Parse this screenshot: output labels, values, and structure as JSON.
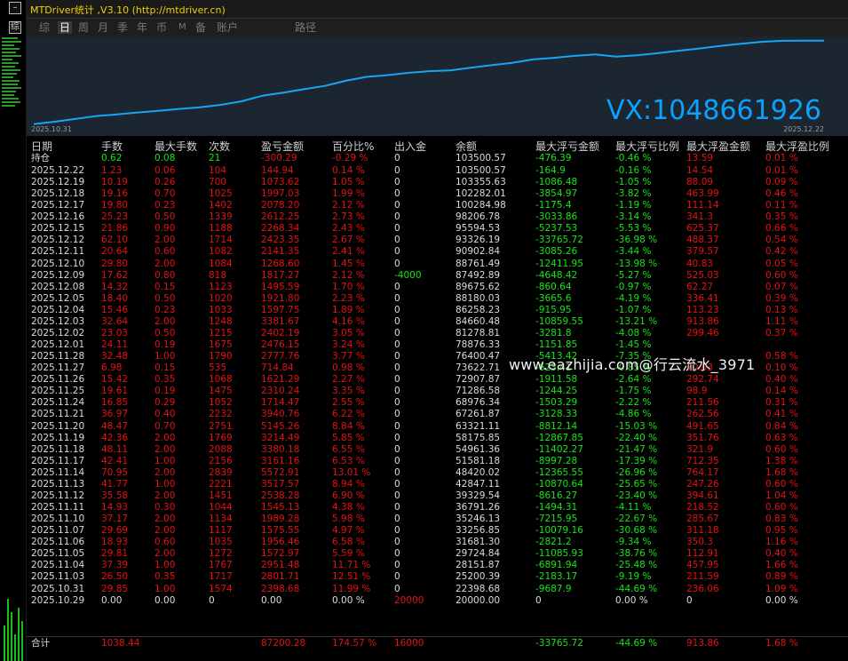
{
  "window": {
    "title": "MTDriver统计 ,V3.10 (http://mtdriver.cn)",
    "left_button": "综"
  },
  "tabs": [
    {
      "label": "综",
      "active": false
    },
    {
      "label": "日",
      "active": true
    },
    {
      "label": "周",
      "active": false
    },
    {
      "label": "月",
      "active": false
    },
    {
      "label": "季",
      "active": false
    },
    {
      "label": "年",
      "active": false
    },
    {
      "label": "币",
      "active": false
    },
    {
      "label": "M",
      "active": false
    },
    {
      "label": "备",
      "active": false
    },
    {
      "label": "账户",
      "active": false
    },
    {
      "label": "路径",
      "active": false
    }
  ],
  "chart_data": {
    "type": "line",
    "series": [
      {
        "values": [
          20000,
          22398.68,
          25200.39,
          28151.87,
          29724.84,
          31681.3,
          33256.85,
          35246.13,
          36791.26,
          39329.54,
          42847.11,
          48420.02,
          51581.18,
          54961.36,
          58175.85,
          63321.11,
          67261.87,
          68976.34,
          71286.58,
          72907.87,
          73622.71,
          76400.47,
          78876.33,
          81278.81,
          84660.48,
          86258.23,
          88180.03,
          89675.62,
          87492.89,
          88761.49,
          90902.84,
          93326.19,
          95594.53,
          98206.78,
          100284.98,
          102282.01,
          103355.63,
          103500.57,
          103500.57
        ]
      }
    ],
    "x_start": "2025.10.31",
    "x_end": "2025.12.22",
    "color": "#15a6f5",
    "background": "#1c2630"
  },
  "chart_overlay": "VX:1048661926",
  "site_watermark": "www.eazhijia.com@行云流水_3971",
  "columns": [
    "日期",
    "手数",
    "最大手数",
    "次数",
    "盈亏金额",
    "百分比%",
    "出入金",
    "余额",
    "最大浮亏金额",
    "最大浮亏比例",
    "最大浮盈金额",
    "最大浮盈比例"
  ],
  "holding": {
    "date": "持仓",
    "lots": "0.62",
    "max_lots": "0.08",
    "count": "21",
    "pnl": "-300.29",
    "pct": "-0.29 %",
    "io": "0",
    "balance": "103500.57",
    "max_dd": "-476.39",
    "max_dd_pct": "-0.46 %",
    "max_fp": "13.59",
    "max_fp_pct": "0.01 %"
  },
  "rows": [
    {
      "date": "2025.12.22",
      "lots": "1.23",
      "max_lots": "0.06",
      "count": "104",
      "pnl": "144.94",
      "pct": "0.14 %",
      "io": "0",
      "balance": "103500.57",
      "max_dd": "-164.9",
      "max_dd_pct": "-0.16 %",
      "max_fp": "14.54",
      "max_fp_pct": "0.01 %"
    },
    {
      "date": "2025.12.19",
      "lots": "10.19",
      "max_lots": "0.26",
      "count": "700",
      "pnl": "1073.62",
      "pct": "1.05 %",
      "io": "0",
      "balance": "103355.63",
      "max_dd": "-1086.48",
      "max_dd_pct": "-1.05 %",
      "max_fp": "88.09",
      "max_fp_pct": "0.09 %"
    },
    {
      "date": "2025.12.18",
      "lots": "19.16",
      "max_lots": "0.70",
      "count": "1025",
      "pnl": "1997.03",
      "pct": "1.99 %",
      "io": "0",
      "balance": "102282.01",
      "max_dd": "-3854.97",
      "max_dd_pct": "-3.82 %",
      "max_fp": "463.99",
      "max_fp_pct": "0.46 %"
    },
    {
      "date": "2025.12.17",
      "lots": "19.80",
      "max_lots": "0.23",
      "count": "1402",
      "pnl": "2078.20",
      "pct": "2.12 %",
      "io": "0",
      "balance": "100284.98",
      "max_dd": "-1175.4",
      "max_dd_pct": "-1.19 %",
      "max_fp": "111.14",
      "max_fp_pct": "0.11 %"
    },
    {
      "date": "2025.12.16",
      "lots": "25.23",
      "max_lots": "0.50",
      "count": "1339",
      "pnl": "2612.25",
      "pct": "2.73 %",
      "io": "0",
      "balance": "98206.78",
      "max_dd": "-3033.86",
      "max_dd_pct": "-3.14 %",
      "max_fp": "341.3",
      "max_fp_pct": "0.35 %"
    },
    {
      "date": "2025.12.15",
      "lots": "21.86",
      "max_lots": "0.90",
      "count": "1188",
      "pnl": "2268.34",
      "pct": "2.43 %",
      "io": "0",
      "balance": "95594.53",
      "max_dd": "-5237.53",
      "max_dd_pct": "-5.53 %",
      "max_fp": "625.37",
      "max_fp_pct": "0.66 %"
    },
    {
      "date": "2025.12.12",
      "lots": "62.10",
      "max_lots": "2.00",
      "count": "1714",
      "pnl": "2423.35",
      "pct": "2.67 %",
      "io": "0",
      "balance": "93326.19",
      "max_dd": "-33765.72",
      "max_dd_pct": "-36.98 %",
      "max_fp": "488.37",
      "max_fp_pct": "0.54 %"
    },
    {
      "date": "2025.12.11",
      "lots": "20.64",
      "max_lots": "0.60",
      "count": "1082",
      "pnl": "2141.35",
      "pct": "2.41 %",
      "io": "0",
      "balance": "90902.84",
      "max_dd": "-3085.26",
      "max_dd_pct": "-3.44 %",
      "max_fp": "379.57",
      "max_fp_pct": "0.42 %"
    },
    {
      "date": "2025.12.10",
      "lots": "29.80",
      "max_lots": "2.00",
      "count": "1084",
      "pnl": "1268.60",
      "pct": "1.45 %",
      "io": "0",
      "balance": "88761.49",
      "max_dd": "-12411.95",
      "max_dd_pct": "-13.98 %",
      "max_fp": "40.83",
      "max_fp_pct": "0.05 %"
    },
    {
      "date": "2025.12.09",
      "lots": "17.62",
      "max_lots": "0.80",
      "count": "818",
      "pnl": "1817.27",
      "pct": "2.12 %",
      "io": "-4000",
      "balance": "87492.89",
      "max_dd": "-4648.42",
      "max_dd_pct": "-5.27 %",
      "max_fp": "525.03",
      "max_fp_pct": "0.60 %"
    },
    {
      "date": "2025.12.08",
      "lots": "14.32",
      "max_lots": "0.15",
      "count": "1123",
      "pnl": "1495.59",
      "pct": "1.70 %",
      "io": "0",
      "balance": "89675.62",
      "max_dd": "-860.64",
      "max_dd_pct": "-0.97 %",
      "max_fp": "62.27",
      "max_fp_pct": "0.07 %"
    },
    {
      "date": "2025.12.05",
      "lots": "18.40",
      "max_lots": "0.50",
      "count": "1020",
      "pnl": "1921.80",
      "pct": "2.23 %",
      "io": "0",
      "balance": "88180.03",
      "max_dd": "-3665.6",
      "max_dd_pct": "-4.19 %",
      "max_fp": "336.41",
      "max_fp_pct": "0.39 %"
    },
    {
      "date": "2025.12.04",
      "lots": "15.46",
      "max_lots": "0.23",
      "count": "1033",
      "pnl": "1597.75",
      "pct": "1.89 %",
      "io": "0",
      "balance": "86258.23",
      "max_dd": "-915.95",
      "max_dd_pct": "-1.07 %",
      "max_fp": "113.23",
      "max_fp_pct": "0.13 %"
    },
    {
      "date": "2025.12.03",
      "lots": "32.64",
      "max_lots": "2.00",
      "count": "1248",
      "pnl": "3381.67",
      "pct": "4.16 %",
      "io": "0",
      "balance": "84660.48",
      "max_dd": "-10859.55",
      "max_dd_pct": "-13.21 %",
      "max_fp": "913.86",
      "max_fp_pct": "1.11 %"
    },
    {
      "date": "2025.12.02",
      "lots": "23.03",
      "max_lots": "0.50",
      "count": "1215",
      "pnl": "2402.19",
      "pct": "3.05 %",
      "io": "0",
      "balance": "81278.81",
      "max_dd": "-3281.8",
      "max_dd_pct": "-4.08 %",
      "max_fp": "299.46",
      "max_fp_pct": "0.37 %"
    },
    {
      "date": "2025.12.01",
      "lots": "24.11",
      "max_lots": "0.19",
      "count": "1675",
      "pnl": "2476.15",
      "pct": "3.24 %",
      "io": "0",
      "balance": "78876.33",
      "max_dd": "-1151.85",
      "max_dd_pct": "-1.45 %",
      "max_fp": "",
      "max_fp_pct": ""
    },
    {
      "date": "2025.11.28",
      "lots": "32.48",
      "max_lots": "1.00",
      "count": "1790",
      "pnl": "2777.76",
      "pct": "3.77 %",
      "io": "0",
      "balance": "76400.47",
      "max_dd": "-5413.42",
      "max_dd_pct": "-7.35 %",
      "max_fp": "",
      "max_fp_pct": "0.58 %"
    },
    {
      "date": "2025.11.27",
      "lots": "6.98",
      "max_lots": "0.15",
      "count": "535",
      "pnl": "714.84",
      "pct": "0.98 %",
      "io": "0",
      "balance": "73622.71",
      "max_dd": "-623.41",
      "max_dd_pct": "-0.85 %",
      "max_fp": "70.03",
      "max_fp_pct": "0.10 %"
    },
    {
      "date": "2025.11.26",
      "lots": "15.42",
      "max_lots": "0.35",
      "count": "1068",
      "pnl": "1621.29",
      "pct": "2.27 %",
      "io": "0",
      "balance": "72907.87",
      "max_dd": "-1911.58",
      "max_dd_pct": "-2.64 %",
      "max_fp": "292.74",
      "max_fp_pct": "0.40 %"
    },
    {
      "date": "2025.11.25",
      "lots": "19.61",
      "max_lots": "0.19",
      "count": "1475",
      "pnl": "2310.24",
      "pct": "3.35 %",
      "io": "0",
      "balance": "71286.58",
      "max_dd": "-1244.25",
      "max_dd_pct": "-1.75 %",
      "max_fp": "98.9",
      "max_fp_pct": "0.14 %"
    },
    {
      "date": "2025.11.24",
      "lots": "16.85",
      "max_lots": "0.29",
      "count": "1052",
      "pnl": "1714.47",
      "pct": "2.55 %",
      "io": "0",
      "balance": "68976.34",
      "max_dd": "-1503.29",
      "max_dd_pct": "-2.22 %",
      "max_fp": "211.56",
      "max_fp_pct": "0.31 %"
    },
    {
      "date": "2025.11.21",
      "lots": "36.97",
      "max_lots": "0.40",
      "count": "2232",
      "pnl": "3940.76",
      "pct": "6.22 %",
      "io": "0",
      "balance": "67261.87",
      "max_dd": "-3128.33",
      "max_dd_pct": "-4.86 %",
      "max_fp": "262.56",
      "max_fp_pct": "0.41 %"
    },
    {
      "date": "2025.11.20",
      "lots": "48.47",
      "max_lots": "0.70",
      "count": "2751",
      "pnl": "5145.26",
      "pct": "8.84 %",
      "io": "0",
      "balance": "63321.11",
      "max_dd": "-8812.14",
      "max_dd_pct": "-15.03 %",
      "max_fp": "491.65",
      "max_fp_pct": "0.84 %"
    },
    {
      "date": "2025.11.19",
      "lots": "42.36",
      "max_lots": "2.00",
      "count": "1769",
      "pnl": "3214.49",
      "pct": "5.85 %",
      "io": "0",
      "balance": "58175.85",
      "max_dd": "-12867.85",
      "max_dd_pct": "-22.40 %",
      "max_fp": "351.76",
      "max_fp_pct": "0.63 %"
    },
    {
      "date": "2025.11.18",
      "lots": "48.11",
      "max_lots": "2.00",
      "count": "2088",
      "pnl": "3380.18",
      "pct": "6.55 %",
      "io": "0",
      "balance": "54961.36",
      "max_dd": "-11402.27",
      "max_dd_pct": "-21.47 %",
      "max_fp": "321.9",
      "max_fp_pct": "0.60 %"
    },
    {
      "date": "2025.11.17",
      "lots": "42.41",
      "max_lots": "1.00",
      "count": "2156",
      "pnl": "3161.16",
      "pct": "6.53 %",
      "io": "0",
      "balance": "51581.18",
      "max_dd": "-8997.28",
      "max_dd_pct": "-17.39 %",
      "max_fp": "712.35",
      "max_fp_pct": "1.38 %"
    },
    {
      "date": "2025.11.14",
      "lots": "70.95",
      "max_lots": "2.00",
      "count": "2839",
      "pnl": "5572.91",
      "pct": "13.01 %",
      "io": "0",
      "balance": "48420.02",
      "max_dd": "-12365.55",
      "max_dd_pct": "-26.96 %",
      "max_fp": "764.17",
      "max_fp_pct": "1.68 %"
    },
    {
      "date": "2025.11.13",
      "lots": "41.77",
      "max_lots": "1.00",
      "count": "2221",
      "pnl": "3517.57",
      "pct": "8.94 %",
      "io": "0",
      "balance": "42847.11",
      "max_dd": "-10870.64",
      "max_dd_pct": "-25.65 %",
      "max_fp": "247.26",
      "max_fp_pct": "0.60 %"
    },
    {
      "date": "2025.11.12",
      "lots": "35.58",
      "max_lots": "2.00",
      "count": "1451",
      "pnl": "2538.28",
      "pct": "6.90 %",
      "io": "0",
      "balance": "39329.54",
      "max_dd": "-8616.27",
      "max_dd_pct": "-23.40 %",
      "max_fp": "394.61",
      "max_fp_pct": "1.04 %"
    },
    {
      "date": "2025.11.11",
      "lots": "14.93",
      "max_lots": "0.30",
      "count": "1044",
      "pnl": "1545.13",
      "pct": "4.38 %",
      "io": "0",
      "balance": "36791.26",
      "max_dd": "-1494.31",
      "max_dd_pct": "-4.11 %",
      "max_fp": "218.52",
      "max_fp_pct": "0.60 %"
    },
    {
      "date": "2025.11.10",
      "lots": "37.17",
      "max_lots": "2.00",
      "count": "1134",
      "pnl": "1989.28",
      "pct": "5.98 %",
      "io": "0",
      "balance": "35246.13",
      "max_dd": "-7215.95",
      "max_dd_pct": "-22.67 %",
      "max_fp": "285.67",
      "max_fp_pct": "0.83 %"
    },
    {
      "date": "2025.11.07",
      "lots": "29.69",
      "max_lots": "2.00",
      "count": "1117",
      "pnl": "1575.55",
      "pct": "4.97 %",
      "io": "0",
      "balance": "33256.85",
      "max_dd": "-10079.16",
      "max_dd_pct": "-30.68 %",
      "max_fp": "311.18",
      "max_fp_pct": "0.95 %"
    },
    {
      "date": "2025.11.06",
      "lots": "18.93",
      "max_lots": "0.60",
      "count": "1035",
      "pnl": "1956.46",
      "pct": "6.58 %",
      "io": "0",
      "balance": "31681.30",
      "max_dd": "-2821.2",
      "max_dd_pct": "-9.34 %",
      "max_fp": "350.3",
      "max_fp_pct": "1.16 %"
    },
    {
      "date": "2025.11.05",
      "lots": "29.81",
      "max_lots": "2.00",
      "count": "1272",
      "pnl": "1572.97",
      "pct": "5.59 %",
      "io": "0",
      "balance": "29724.84",
      "max_dd": "-11085.93",
      "max_dd_pct": "-38.76 %",
      "max_fp": "112.91",
      "max_fp_pct": "0.40 %"
    },
    {
      "date": "2025.11.04",
      "lots": "37.39",
      "max_lots": "1.00",
      "count": "1767",
      "pnl": "2951.48",
      "pct": "11.71 %",
      "io": "0",
      "balance": "28151.87",
      "max_dd": "-6891.94",
      "max_dd_pct": "-25.48 %",
      "max_fp": "457.95",
      "max_fp_pct": "1.66 %"
    },
    {
      "date": "2025.11.03",
      "lots": "26.50",
      "max_lots": "0.35",
      "count": "1717",
      "pnl": "2801.71",
      "pct": "12.51 %",
      "io": "0",
      "balance": "25200.39",
      "max_dd": "-2183.17",
      "max_dd_pct": "-9.19 %",
      "max_fp": "211.59",
      "max_fp_pct": "0.89 %"
    },
    {
      "date": "2025.10.31",
      "lots": "29.85",
      "max_lots": "1.00",
      "count": "1574",
      "pnl": "2398.68",
      "pct": "11.99 %",
      "io": "0",
      "balance": "22398.68",
      "max_dd": "-9687.9",
      "max_dd_pct": "-44.69 %",
      "max_fp": "236.06",
      "max_fp_pct": "1.09 %"
    },
    {
      "date": "2025.10.29",
      "lots": "0.00",
      "max_lots": "0.00",
      "count": "0",
      "pnl": "0.00",
      "pct": "0.00 %",
      "io": "20000",
      "balance": "20000.00",
      "max_dd": "0",
      "max_dd_pct": "0.00 %",
      "max_fp": "0",
      "max_fp_pct": "0.00 %"
    }
  ],
  "total": {
    "date": "合计",
    "lots": "1038.44",
    "max_lots": "",
    "count": "",
    "pnl": "87200.28",
    "pct": "174.57 %",
    "io": "16000",
    "balance": "",
    "max_dd": "-33765.72",
    "max_dd_pct": "-44.69 %",
    "max_fp": "913.86",
    "max_fp_pct": "1.68 %"
  },
  "colors": {
    "red": "#e81010",
    "green": "#16e616",
    "title": "#f0d000",
    "line": "#15a6f5"
  }
}
